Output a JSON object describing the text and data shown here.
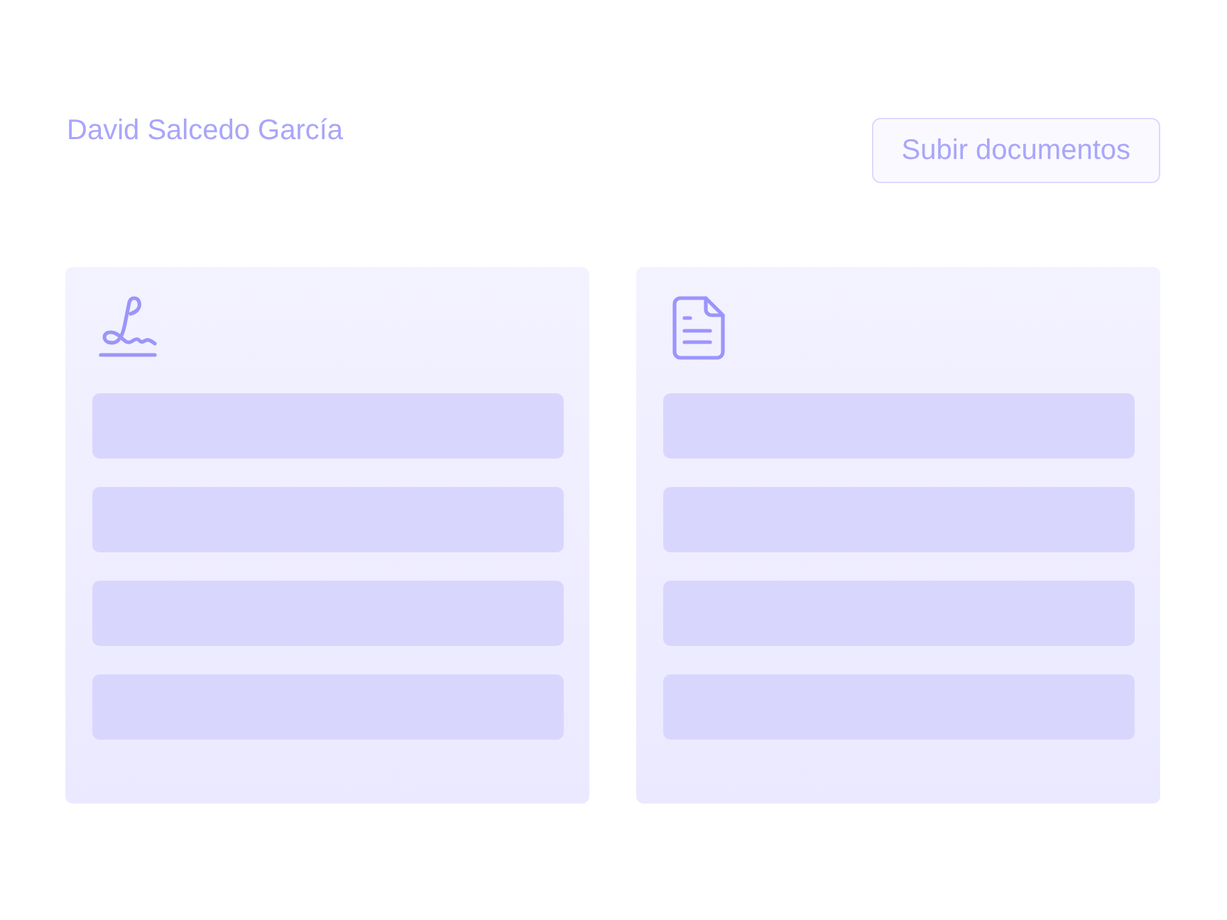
{
  "header": {
    "name": "David Salcedo García",
    "upload_button": {
      "label": "Subir documentos"
    }
  },
  "cards": [
    {
      "kind": "signature"
    },
    {
      "kind": "document"
    }
  ]
}
